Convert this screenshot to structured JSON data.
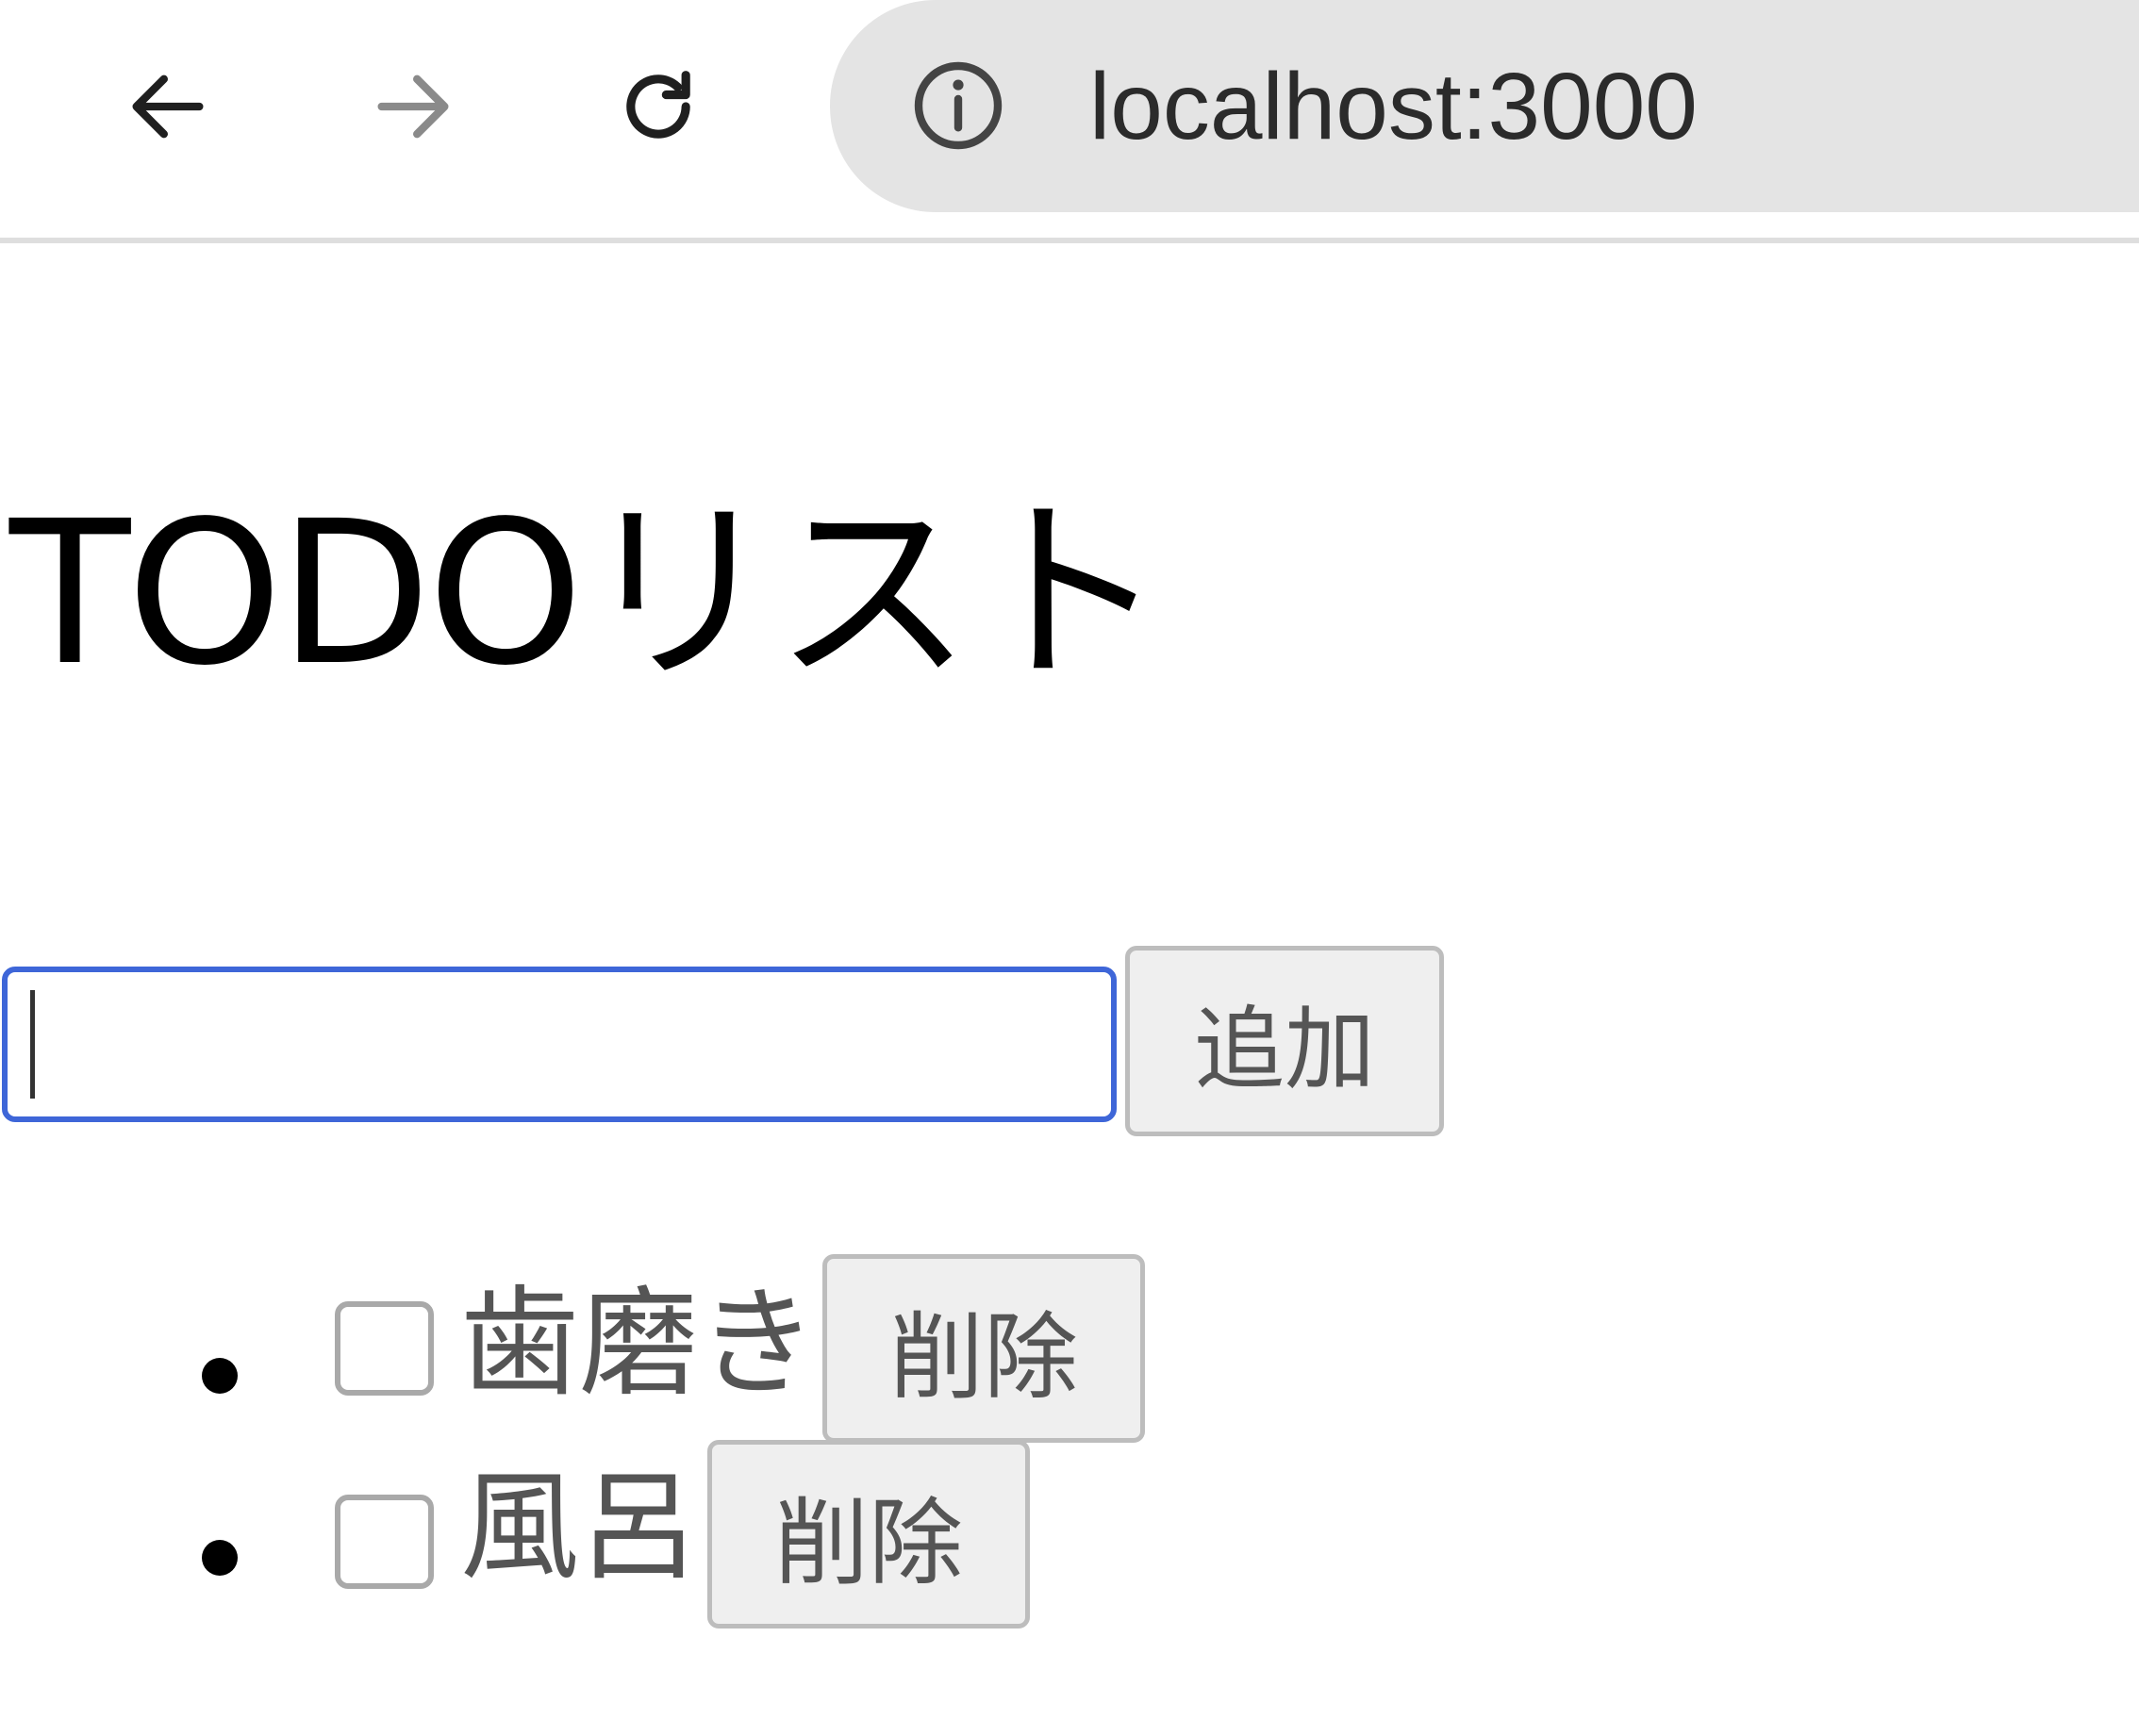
{
  "browser": {
    "url": "localhost:3000",
    "icons": {
      "back": "arrow-left-icon",
      "forward": "arrow-right-icon",
      "reload": "reload-icon",
      "site_info": "info-icon"
    }
  },
  "page": {
    "title": "TODOリスト",
    "input": {
      "value": "",
      "placeholder": ""
    },
    "add_button_label": "追加",
    "todos": [
      {
        "text": "歯磨き",
        "checked": false,
        "delete_label": "削除"
      },
      {
        "text": "風呂",
        "checked": false,
        "delete_label": "削除"
      }
    ]
  },
  "colors": {
    "focus_border": "#3e66d8",
    "button_bg": "#efefef",
    "omnibox_bg": "#e4e4e4"
  }
}
